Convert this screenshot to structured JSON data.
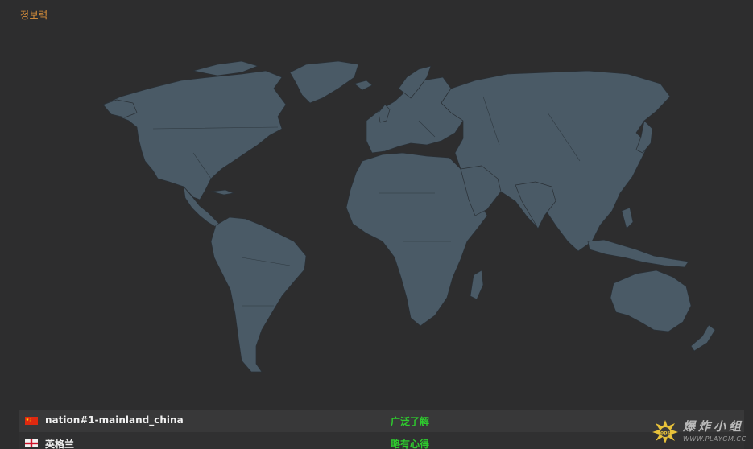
{
  "panel": {
    "title": "정보력"
  },
  "map": {
    "land_color": "#4a5a66",
    "background_color": "#2d2d2e"
  },
  "nations": [
    {
      "flag": "china-flag-icon",
      "name": "nation#1-mainland_china",
      "level": "广泛了解",
      "level_color": "#2ecc2e"
    },
    {
      "flag": "england-flag-icon",
      "name": "英格兰",
      "level": "略有心得",
      "level_color": "#2ecc2e"
    }
  ],
  "watermark": {
    "text": "爆炸小组",
    "url": "WWW.PLAYGM.CC"
  }
}
